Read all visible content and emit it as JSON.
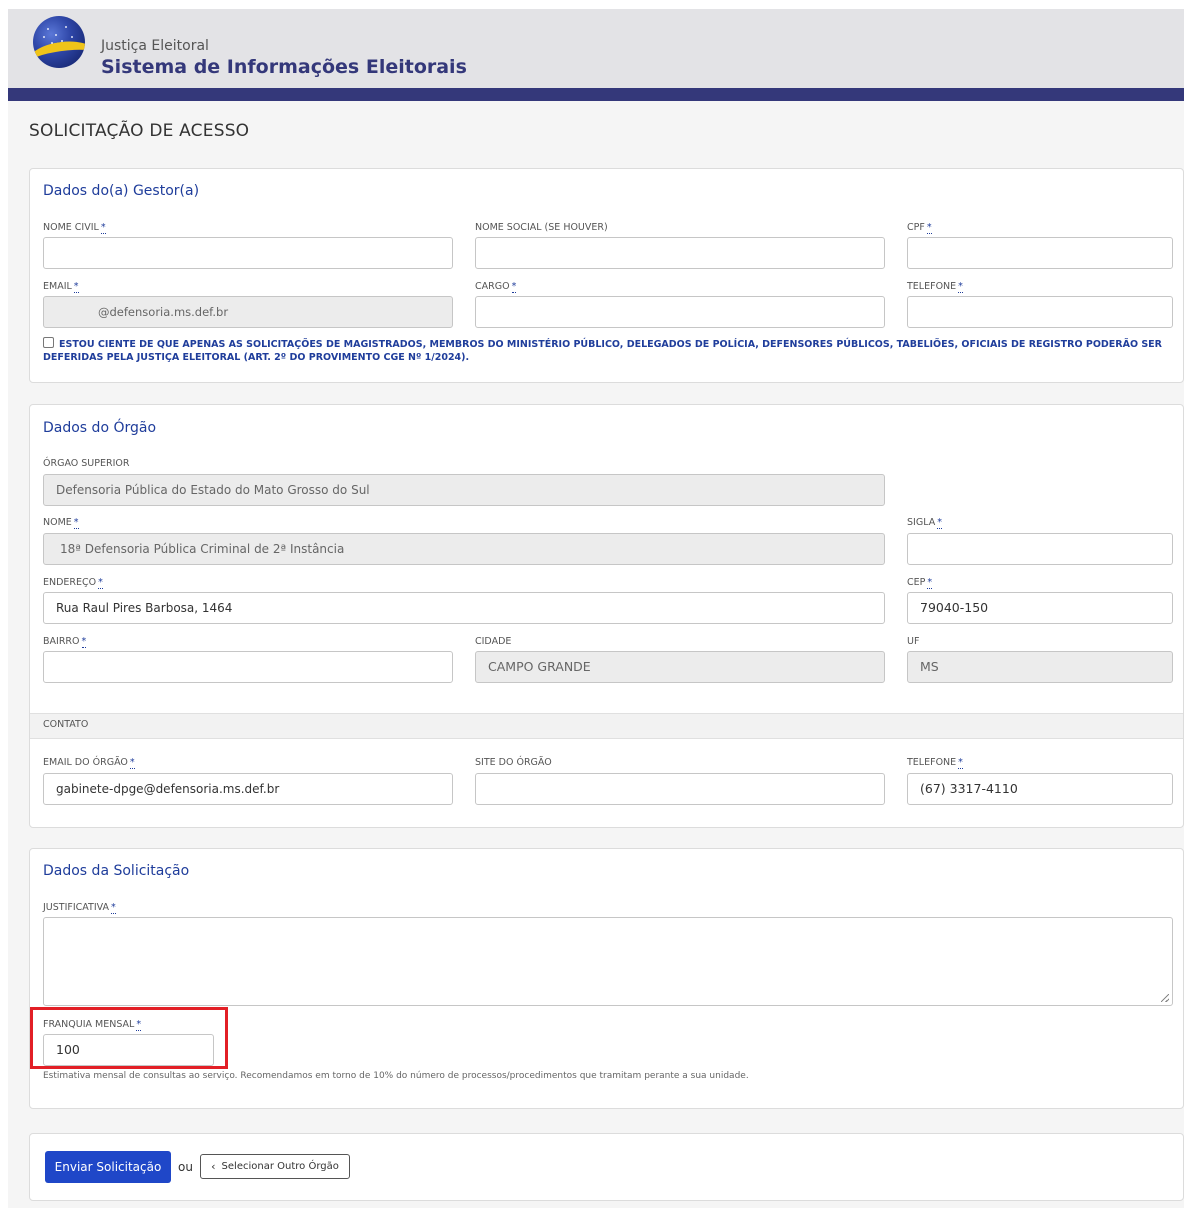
{
  "header": {
    "brand_small": "Justiça Eleitoral",
    "brand_big": "Sistema de Informações Eleitorais"
  },
  "page_title": "SOLICITAÇÃO DE ACESSO",
  "gestor": {
    "title": "Dados do(a) Gestor(a)",
    "nome_civil": {
      "label": "NOME CIVIL",
      "value": ""
    },
    "nome_social": {
      "label": "NOME SOCIAL (SE HOUVER)",
      "value": ""
    },
    "cpf": {
      "label": "CPF",
      "value": ""
    },
    "email": {
      "label": "EMAIL",
      "value": "@defensoria.ms.def.br"
    },
    "cargo": {
      "label": "CARGO",
      "value": ""
    },
    "telefone": {
      "label": "TELEFONE",
      "value": ""
    },
    "required_mark": "*",
    "notice": "ESTOU CIENTE DE QUE APENAS AS SOLICITAÇÕES DE MAGISTRADOS, MEMBROS DO MINISTÉRIO PÚBLICO, DELEGADOS DE POLÍCIA, DEFENSORES PÚBLICOS, TABELIÕES, OFICIAIS DE REGISTRO PODERÃO SER DEFERIDAS PELA JUSTIÇA ELEITORAL (ART. 2º DO PROVIMENTO CGE Nº 1/2024)."
  },
  "orgao": {
    "title": "Dados do Órgão",
    "orgao_superior": {
      "label": "ÓRGAO SUPERIOR",
      "value": "Defensoria Pública do Estado do Mato Grosso do Sul"
    },
    "nome": {
      "label": "NOME",
      "value": "18ª Defensoria Pública Criminal de 2ª Instância"
    },
    "sigla": {
      "label": "SIGLA",
      "value": ""
    },
    "endereco": {
      "label": "ENDEREÇO",
      "value": "Rua Raul Pires Barbosa, 1464"
    },
    "cep": {
      "label": "CEP",
      "value": "79040-150"
    },
    "bairro": {
      "label": "BAIRRO",
      "value": ""
    },
    "cidade": {
      "label": "CIDADE",
      "value": "CAMPO GRANDE"
    },
    "uf": {
      "label": "UF",
      "value": "MS"
    },
    "contato_label": "CONTATO",
    "email_orgao": {
      "label": "EMAIL DO ÓRGÃO",
      "value": "gabinete-dpge@defensoria.ms.def.br"
    },
    "site_orgao": {
      "label": "SITE DO ÓRGÃO",
      "value": ""
    },
    "telefone": {
      "label": "TELEFONE",
      "value": "(67) 3317-4110"
    }
  },
  "solicitacao": {
    "title": "Dados da Solicitação",
    "justificativa": {
      "label": "JUSTIFICATIVA",
      "value": ""
    },
    "franquia": {
      "label": "FRANQUIA MENSAL",
      "value": "100"
    },
    "hint": "Estimativa mensal de consultas ao serviço. Recomendamos em torno de 10% do número de processos/procedimentos que tramitam perante a sua unidade."
  },
  "actions": {
    "submit_label": "Enviar Solicitação",
    "or_label": "ou",
    "secondary_label": "Selecionar Outro Órgão"
  },
  "colors": {
    "brand_navy": "#34387a",
    "link_blue": "#1f3d9b",
    "primary_button": "#1f47c8",
    "highlight_red": "#e21f26"
  }
}
